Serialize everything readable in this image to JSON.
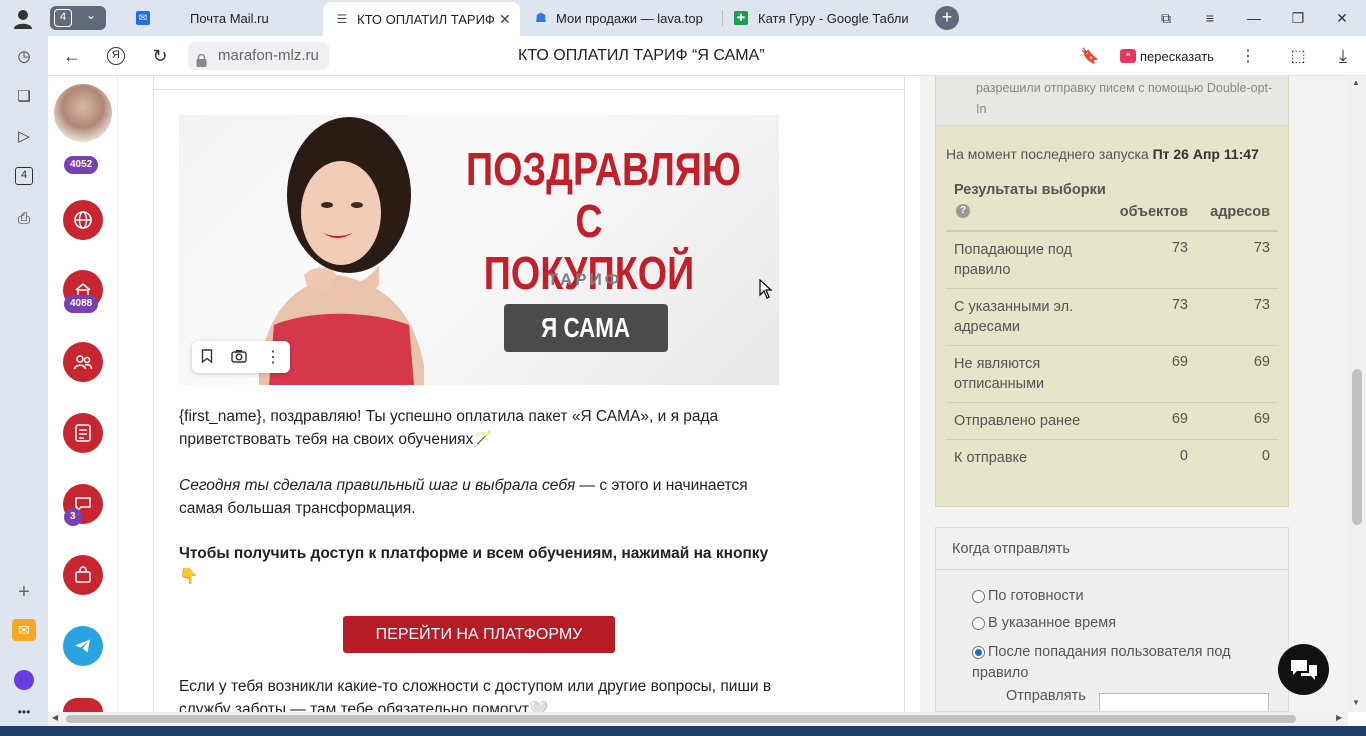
{
  "tabs": [
    {
      "label": "Почта Mail.ru",
      "icon": "mail-icon",
      "color": "#1e6ee6"
    },
    {
      "label": "КТО ОПЛАТИЛ ТАРИФ",
      "icon": "doc-icon",
      "color": "#555555"
    },
    {
      "label": "Мои продажи — lava.top",
      "icon": "lava-icon",
      "color": "#2d7de0"
    },
    {
      "label": "Катя Гуру - Google Табли",
      "icon": "sheets-icon",
      "color": "#1a9e4b"
    }
  ],
  "tab_counter": "4",
  "address": {
    "domain": "marafon-mlz.ru",
    "page_title": "КТО ОПЛАТИЛ ТАРИФ “Я САМА”",
    "retell_label": "пересказать"
  },
  "browser_sidebar": {
    "counter": "4"
  },
  "site_nav": {
    "profile_badge": "4052",
    "badge_2": "4088",
    "badge_3": "3"
  },
  "email": {
    "banner_title": "ПОЗДРАВЛЯЮ С ПОКУПКОЙ",
    "banner_subtitle": "ТАРИФ",
    "banner_plan": "Я САМА",
    "paragraph1": "{first_name}, поздравляю! Ты успешно оплатила пакет «Я САМА», и я рада приветствовать тебя на своих обучениях🪄",
    "paragraph2_italic": "Сегодня ты сделала правильный шаг и выбрала себя",
    "paragraph2_rest": " — с этого и начинается самая большая трансформация.",
    "paragraph3": "Чтобы получить доступ к платформе и всем обучениям, нажимай на кнопку👇",
    "cta_label": "ПЕРЕЙТИ НА ПЛАТФОРМУ",
    "paragraph4": "Если у тебя возникли какие-то сложности с доступом или другие вопросы, пиши в службу заботы — там тебе обязательно помогут🤍"
  },
  "stats": {
    "double_opt_text": "разрешили отправку писем с помощью Double-opt-In",
    "launch_prefix": "На момент последнего запуска",
    "launch_time": "Пт 26 Апр 11:47",
    "header_title": "Результаты выборки",
    "col_objects": "объектов",
    "col_addresses": "адресов",
    "rows": [
      {
        "label": "Попадающие под правило",
        "objects": "73",
        "addresses": "73"
      },
      {
        "label": "С указанными эл. адресами",
        "objects": "73",
        "addresses": "73"
      },
      {
        "label": "Не являются отписанными",
        "objects": "69",
        "addresses": "69"
      },
      {
        "label": "Отправлено ранее",
        "objects": "69",
        "addresses": "69"
      },
      {
        "label": "К отправке",
        "objects": "0",
        "addresses": "0"
      }
    ]
  },
  "when_to_send": {
    "title": "Когда отправлять",
    "options": [
      "По готовности",
      "В указанное время",
      "После попадания пользователя под правило"
    ],
    "selected_index": 2,
    "send_label": "Отправлять"
  },
  "colors": {
    "brand_red": "#c21f2a",
    "stats_bg": "#e6e4c9",
    "badge_purple": "#7b3fb4"
  }
}
